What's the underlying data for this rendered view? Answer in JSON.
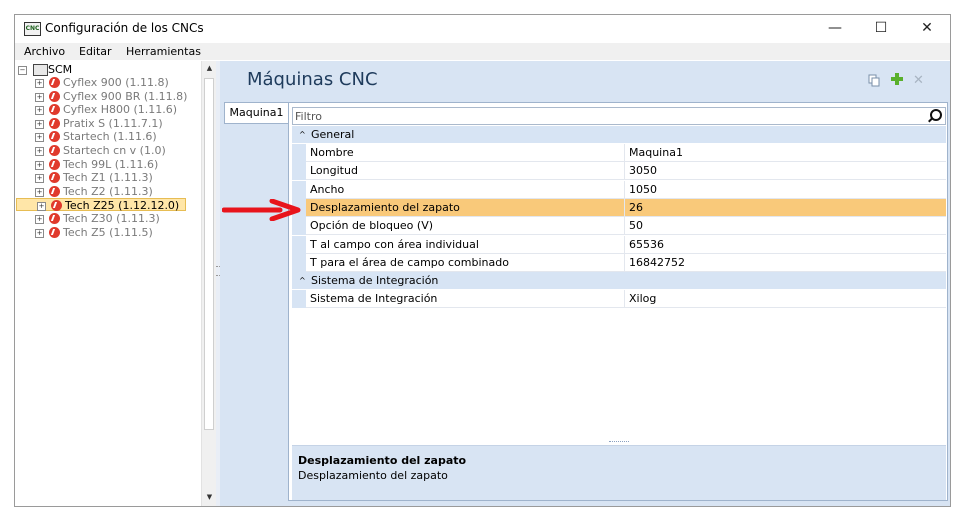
{
  "window": {
    "icon_text": "CNC",
    "title": "Configuración de los CNCs",
    "minimize": "—",
    "maximize": "☐",
    "close": "✕"
  },
  "menu": [
    "Archivo",
    "Editar",
    "Herramientas"
  ],
  "tree": {
    "root": "SCM",
    "items": [
      {
        "label": "Cyflex 900 (1.11.8)",
        "selected": false
      },
      {
        "label": "Cyflex 900 BR (1.11.8)",
        "selected": false
      },
      {
        "label": "Cyflex H800 (1.11.6)",
        "selected": false
      },
      {
        "label": "Pratix S (1.11.7.1)",
        "selected": false
      },
      {
        "label": "Startech (1.11.6)",
        "selected": false
      },
      {
        "label": "Startech cn v (1.0)",
        "selected": false
      },
      {
        "label": "Tech 99L (1.11.6)",
        "selected": false
      },
      {
        "label": "Tech Z1 (1.11.3)",
        "selected": false
      },
      {
        "label": "Tech Z2 (1.11.3)",
        "selected": false
      },
      {
        "label": "Tech Z25 (1.12.12.0)",
        "selected": true
      },
      {
        "label": "Tech Z30 (1.11.3)",
        "selected": false
      },
      {
        "label": "Tech Z5 (1.11.5)",
        "selected": false
      }
    ]
  },
  "panel": {
    "title": "Máquinas CNC",
    "tab": "Maquina1",
    "filter_placeholder": "Filtro",
    "categories": [
      {
        "label": "General",
        "rows": [
          {
            "name": "Nombre",
            "value": "Maquina1",
            "selected": false
          },
          {
            "name": "Longitud",
            "value": "3050",
            "selected": false
          },
          {
            "name": "Ancho",
            "value": "1050",
            "selected": false
          },
          {
            "name": "Desplazamiento del zapato",
            "value": "26",
            "selected": true
          },
          {
            "name": "Opción de bloqueo (V)",
            "value": "50",
            "selected": false
          },
          {
            "name": "T al campo con área individual",
            "value": "65536",
            "selected": false
          },
          {
            "name": "T para el área de campo combinado",
            "value": "16842752",
            "selected": false
          }
        ]
      },
      {
        "label": "Sistema de Integración",
        "rows": [
          {
            "name": "Sistema de Integración",
            "value": "Xilog",
            "selected": false
          }
        ]
      }
    ],
    "description": {
      "title": "Desplazamiento del zapato",
      "text": "Desplazamiento del zapato"
    }
  },
  "colors": {
    "accent_selection": "#f9c97a",
    "tree_selection": "#ffe6a8",
    "panel_bg": "#d8e4f3",
    "arrow": "#e8141c",
    "add_icon": "#59b02c"
  },
  "icons": [
    "copy-icon",
    "add-icon",
    "delete-icon",
    "search-icon"
  ]
}
